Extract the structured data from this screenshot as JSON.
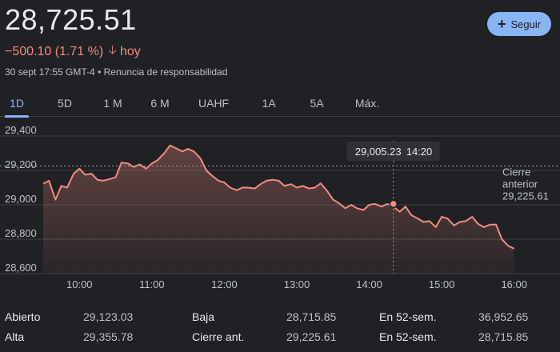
{
  "header": {
    "price": "28,725.51",
    "change": "−500.10 (1.71 %)",
    "change_period": "hoy",
    "timestamp": "30 sept 17:55 GMT-4",
    "separator": "•",
    "disclaimer": "Renuncia de responsabilidad",
    "follow_label": "Seguir"
  },
  "colors": {
    "accent": "#8ab4f8",
    "negative": "#f28b82",
    "background": "#202124"
  },
  "tabs": [
    {
      "label": "1D",
      "active": true
    },
    {
      "label": "5D",
      "active": false
    },
    {
      "label": "1 M",
      "active": false
    },
    {
      "label": "6 M",
      "active": false
    },
    {
      "label": "UAHF",
      "active": false
    },
    {
      "label": "1A",
      "active": false
    },
    {
      "label": "5A",
      "active": false
    },
    {
      "label": "Máx.",
      "active": false
    }
  ],
  "chart_data": {
    "type": "area",
    "y_ticks": [
      "29,400",
      "29,200",
      "29,000",
      "28,800",
      "28,600"
    ],
    "y_tick_values": [
      29400,
      29200,
      29000,
      28800,
      28600
    ],
    "x_ticks": [
      "10:00",
      "11:00",
      "12:00",
      "13:00",
      "14:00",
      "15:00",
      "16:00"
    ],
    "x_tick_values": [
      10,
      11,
      12,
      13,
      14,
      15,
      16
    ],
    "xlim": [
      9.5,
      16.5
    ],
    "ylim": [
      28600,
      29400
    ],
    "grid": true,
    "reference_line": {
      "label_line1": "Cierre",
      "label_line2": "anterior",
      "value_text": "29,225.61",
      "value": 29225.61
    },
    "hover": {
      "value_text": "29,005.23",
      "time_text": "14:20",
      "x": 14.333,
      "y": 29005.23
    },
    "series": [
      {
        "x": [
          9.5,
          9.58,
          9.67,
          9.75,
          9.83,
          9.92,
          10.0,
          10.08,
          10.17,
          10.25,
          10.33,
          10.42,
          10.5,
          10.58,
          10.67,
          10.75,
          10.83,
          10.92,
          11.0,
          11.08,
          11.17,
          11.25,
          11.33,
          11.42,
          11.5,
          11.58,
          11.67,
          11.75,
          11.83,
          11.92,
          12.0,
          12.08,
          12.17,
          12.25,
          12.33,
          12.42,
          12.5,
          12.58,
          12.67,
          12.75,
          12.83,
          12.92,
          13.0,
          13.08,
          13.17,
          13.25,
          13.33,
          13.42,
          13.5,
          13.58,
          13.67,
          13.75,
          13.83,
          13.92,
          14.0,
          14.08,
          14.17,
          14.25,
          14.33,
          14.42,
          14.5,
          14.58,
          14.67,
          14.75,
          14.83,
          14.92,
          15.0,
          15.08,
          15.17,
          15.25,
          15.33,
          15.42,
          15.5,
          15.58,
          15.67,
          15.75,
          15.83,
          15.92,
          16.0
        ],
        "y": [
          29123,
          29140,
          29030,
          29110,
          29100,
          29180,
          29210,
          29175,
          29180,
          29145,
          29140,
          29150,
          29160,
          29245,
          29240,
          29220,
          29235,
          29210,
          29240,
          29260,
          29300,
          29345,
          29330,
          29310,
          29325,
          29310,
          29270,
          29200,
          29170,
          29140,
          29130,
          29100,
          29085,
          29100,
          29100,
          29095,
          29120,
          29140,
          29145,
          29140,
          29110,
          29120,
          29100,
          29110,
          29095,
          29100,
          29125,
          29080,
          29030,
          29010,
          28980,
          29000,
          28980,
          28970,
          29000,
          29005,
          28990,
          29005,
          28990,
          28960,
          28990,
          28940,
          28920,
          28900,
          28905,
          28870,
          28930,
          28920,
          28880,
          28900,
          28905,
          28930,
          28890,
          28870,
          28885,
          28885,
          28800,
          28760,
          28745
        ]
      }
    ]
  },
  "stats": {
    "open_label": "Abierto",
    "open_value": "29,123.03",
    "high_label": "Alta",
    "high_value": "29,355.78",
    "low_label": "Baja",
    "low_value": "28,715.85",
    "prev_close_label": "Cierre ant.",
    "prev_close_value": "29,225.61",
    "wk52_high_label": "En 52-sem.",
    "wk52_high_value": "36,952.65",
    "wk52_low_label": "En 52-sem.",
    "wk52_low_value": "28,715.85"
  }
}
